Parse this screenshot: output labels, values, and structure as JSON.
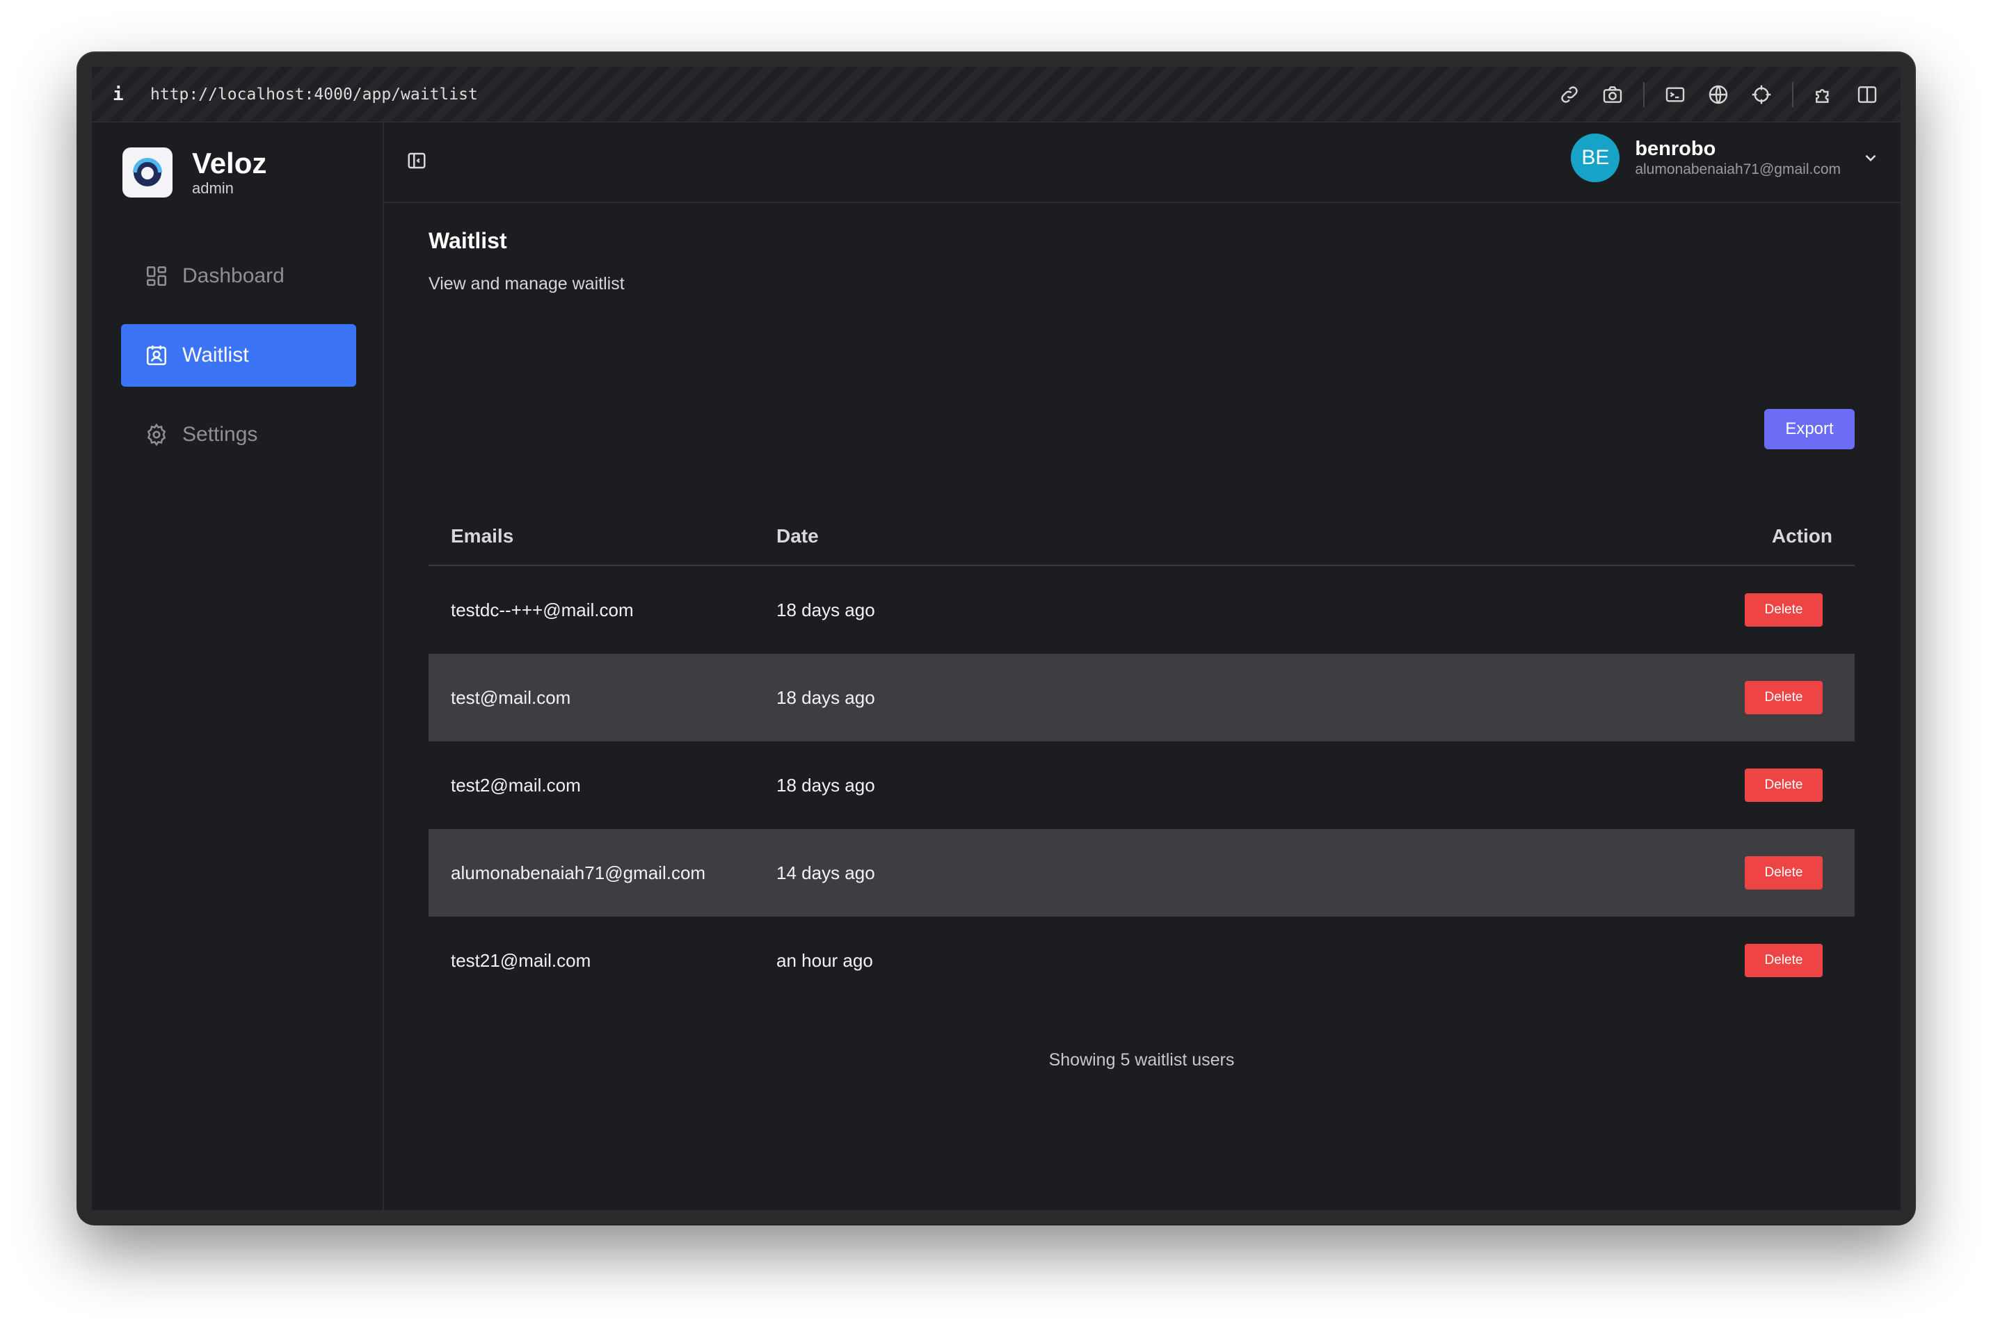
{
  "browser": {
    "info_glyph": "i",
    "url": "http://localhost:4000/app/waitlist",
    "icons": [
      "link-icon",
      "camera-icon",
      "terminal-icon",
      "globe-icon",
      "crosshair-icon",
      "puzzle-icon",
      "split-view-icon"
    ]
  },
  "brand": {
    "name": "Veloz",
    "role": "admin"
  },
  "sidebar": {
    "items": [
      {
        "label": "Dashboard",
        "icon": "dashboard-icon",
        "active": false
      },
      {
        "label": "Waitlist",
        "icon": "waitlist-icon",
        "active": true
      },
      {
        "label": "Settings",
        "icon": "gear-icon",
        "active": false
      }
    ]
  },
  "user": {
    "initials": "BE",
    "name": "benrobo",
    "email": "alumonabenaiah71@gmail.com",
    "avatar_color": "#17a3c8"
  },
  "page": {
    "title": "Waitlist",
    "subtitle": "View and manage waitlist",
    "export_label": "Export"
  },
  "table": {
    "headers": {
      "email": "Emails",
      "date": "Date",
      "action": "Action"
    },
    "rows": [
      {
        "email": "testdc--+++@mail.com",
        "date": "18 days ago",
        "action": "Delete"
      },
      {
        "email": "test@mail.com",
        "date": "18 days ago",
        "action": "Delete"
      },
      {
        "email": "test2@mail.com",
        "date": "18 days ago",
        "action": "Delete"
      },
      {
        "email": "alumonabenaiah71@gmail.com",
        "date": "14 days ago",
        "action": "Delete"
      },
      {
        "email": "test21@mail.com",
        "date": "an hour ago",
        "action": "Delete"
      }
    ],
    "footer": "Showing 5 waitlist users"
  },
  "colors": {
    "accent": "#3b74f6",
    "export": "#6b6ef4",
    "danger": "#ef4444",
    "background": "#1c1d21"
  }
}
